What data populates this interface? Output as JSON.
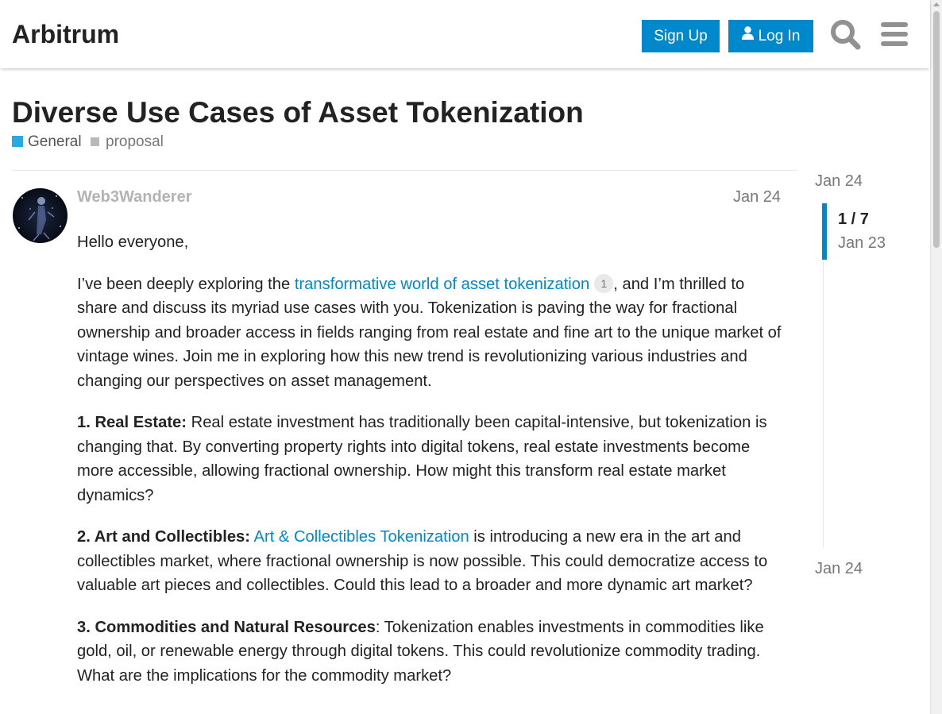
{
  "header": {
    "site_title": "Arbitrum",
    "signup_label": "Sign Up",
    "login_label": "Log In"
  },
  "topic": {
    "title": "Diverse Use Cases of Asset Tokenization",
    "category": "General",
    "tag": "proposal"
  },
  "post": {
    "username": "Web3Wanderer",
    "date": "Jan 24",
    "greeting": "Hello everyone,",
    "p1_before": "I’ve been deeply exploring the ",
    "p1_link": "transformative world of asset tokenization",
    "p1_link_clicks": "1",
    "p1_after": ", and I’m thrilled to share and discuss its myriad use cases with you. Tokenization is paving the way for fractional ownership and broader access in fields ranging from real estate and fine art to the unique market of vintage wines. Join me in exploring how this new trend is revolutionizing various industries and changing our perspectives on asset management.",
    "s1_heading": "1. Real Estate:",
    "s1_text": " Real estate investment has traditionally been capital-intensive, but tokenization is changing that. By converting property rights into digital tokens, real estate investments become more accessible, allowing fractional ownership. How might this transform real estate market dynamics?",
    "s2_heading": "2. Art and Collectibles:",
    "s2_link": "Art & Collectibles Tokenization",
    "s2_text": " is introducing a new era in the art and collectibles market, where fractional ownership is now possible. This could democratize access to valuable art pieces and collectibles. Could this lead to a broader and more dynamic art market?",
    "s3_heading": "3. Commodities and Natural Resources",
    "s3_text": ": Tokenization enables investments in commodities like gold, oil, or renewable energy through digital tokens. This could revolutionize commodity trading. What are the implications for the commodity market?"
  },
  "timeline": {
    "start_date": "Jan 24",
    "position": "1 / 7",
    "current_date": "Jan 23",
    "end_date": "Jan 24",
    "progress_fraction": 0.14
  },
  "colors": {
    "accent": "#0088cc",
    "category_general": "#25aae1",
    "tag_square": "#b9b9b9"
  }
}
